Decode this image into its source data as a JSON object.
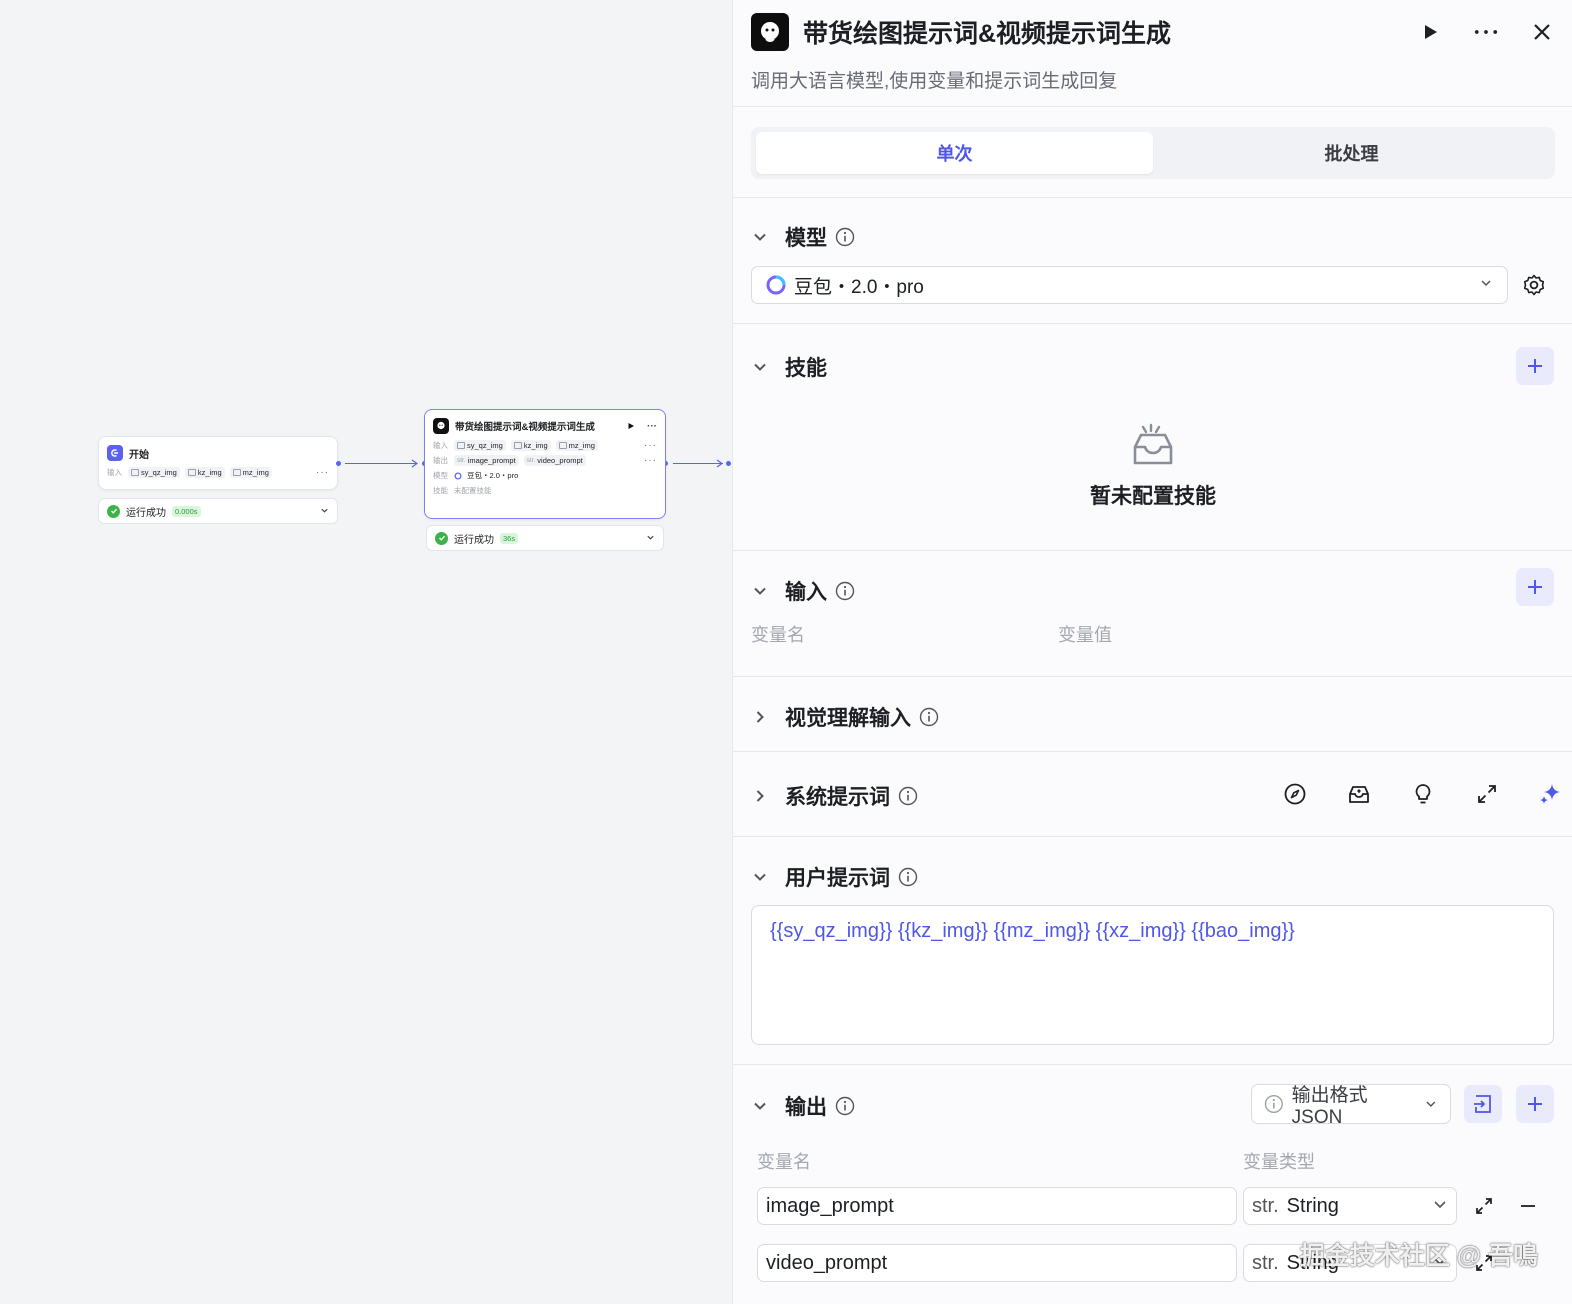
{
  "canvas": {
    "start_node": {
      "title": "开始",
      "input_label": "输入",
      "inputs": [
        "sy_qz_img",
        "kz_img",
        "mz_img"
      ],
      "more": "···",
      "status_text": "运行成功",
      "status_time": "0.000s"
    },
    "llm_node": {
      "title": "带货绘图提示词&视频提示词生成",
      "input_label": "输入",
      "inputs": [
        "sy_qz_img",
        "kz_img",
        "mz_img"
      ],
      "output_label": "输出",
      "output_tag": "str.",
      "outputs": [
        "image_prompt",
        "video_prompt"
      ],
      "model_label": "模型",
      "model_value": "豆包・2.0・pro",
      "skill_label": "技能",
      "skill_value": "未配置技能",
      "more": "···",
      "status_text": "运行成功",
      "status_time": "36s"
    }
  },
  "panel": {
    "title": "带货绘图提示词&视频提示词生成",
    "description": "调用大语言模型,使用变量和提示词生成回复",
    "tabs": [
      {
        "label": "单次",
        "active": true
      },
      {
        "label": "批处理",
        "active": false
      }
    ],
    "model": {
      "section_title": "模型",
      "selected": "豆包・2.0・pro"
    },
    "skills": {
      "section_title": "技能",
      "empty_text": "暂未配置技能"
    },
    "input": {
      "section_title": "输入",
      "col_name": "变量名",
      "col_value": "变量值"
    },
    "vision": {
      "section_title": "视觉理解输入"
    },
    "system_prompt": {
      "section_title": "系统提示词"
    },
    "user_prompt": {
      "section_title": "用户提示词",
      "content": "{{sy_qz_img}} {{kz_img}} {{mz_img}} {{xz_img}} {{bao_img}}"
    },
    "output": {
      "section_title": "输出",
      "format_button": "输出格式JSON",
      "col_name": "变量名",
      "col_type": "变量类型",
      "type_prefix": "str.",
      "rows": [
        {
          "name": "image_prompt",
          "type": "String"
        },
        {
          "name": "video_prompt",
          "type": "String"
        }
      ]
    }
  },
  "watermark": "掘金技术社区 @ 吾鳴",
  "colors": {
    "accent": "#4e57e8",
    "success": "#3bb346",
    "edge": "#5c62f0"
  }
}
